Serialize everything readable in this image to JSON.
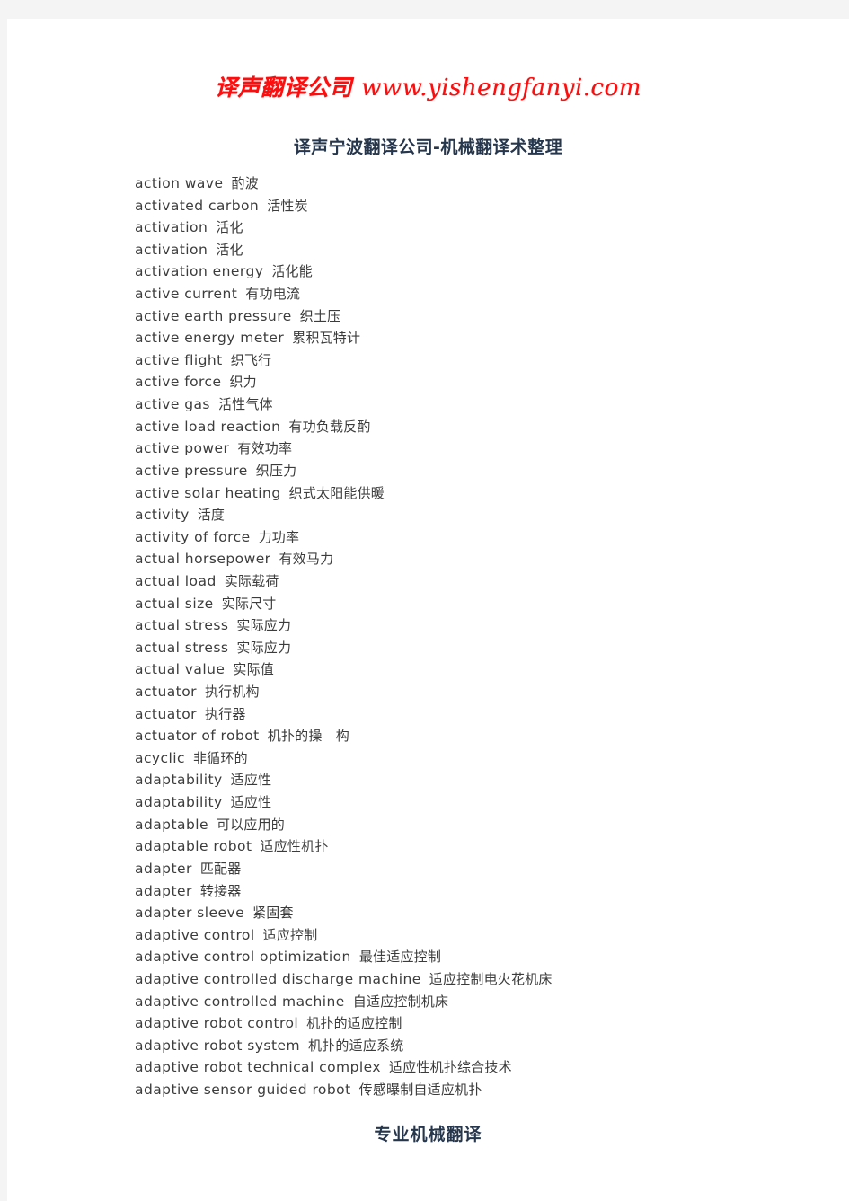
{
  "header": {
    "brand_cn": "译声翻译公司",
    "brand_url": "www.yishengfanyi.com",
    "brand_color": "#fd0d0d"
  },
  "title": "译声宁波翻译公司-机械翻译术整理",
  "footer": "专业机械翻译",
  "colors": {
    "page_background": "#ffffff",
    "canvas_background": "#f4f4f4",
    "title_color": "#26374d",
    "body_text": "#3c3c3c"
  },
  "glossary": [
    {
      "term": "action wave",
      "gloss": "酌波"
    },
    {
      "term": "activated carbon",
      "gloss": "活性炭"
    },
    {
      "term": "activation",
      "gloss": "活化"
    },
    {
      "term": "activation",
      "gloss": "活化"
    },
    {
      "term": "activation energy",
      "gloss": "活化能"
    },
    {
      "term": "active current",
      "gloss": "有功电流"
    },
    {
      "term": "active earth pressure",
      "gloss": "织土压"
    },
    {
      "term": "active energy meter",
      "gloss": "累积瓦特计"
    },
    {
      "term": "active flight",
      "gloss": "织飞行"
    },
    {
      "term": "active force",
      "gloss": "织力"
    },
    {
      "term": "active gas",
      "gloss": "活性气体"
    },
    {
      "term": "active load reaction",
      "gloss": "有功负载反酌"
    },
    {
      "term": "active power",
      "gloss": "有效功率"
    },
    {
      "term": "active pressure",
      "gloss": "织压力"
    },
    {
      "term": "active solar heating",
      "gloss": "织式太阳能供暖"
    },
    {
      "term": "activity",
      "gloss": "活度"
    },
    {
      "term": "activity of force",
      "gloss": "力功率"
    },
    {
      "term": "actual horsepower",
      "gloss": "有效马力"
    },
    {
      "term": "actual load",
      "gloss": "实际载荷"
    },
    {
      "term": "actual size",
      "gloss": "实际尺寸"
    },
    {
      "term": "actual stress",
      "gloss": "实际应力"
    },
    {
      "term": "actual stress",
      "gloss": "实际应力"
    },
    {
      "term": "actual value",
      "gloss": "实际值"
    },
    {
      "term": "actuator",
      "gloss": "执行机构"
    },
    {
      "term": "actuator",
      "gloss": "执行器"
    },
    {
      "term": "actuator of robot",
      "gloss": "机扑的操　构"
    },
    {
      "term": "acyclic",
      "gloss": "非循环的"
    },
    {
      "term": "adaptability",
      "gloss": "适应性"
    },
    {
      "term": "adaptability",
      "gloss": "适应性"
    },
    {
      "term": "adaptable",
      "gloss": "可以应用的"
    },
    {
      "term": "adaptable robot",
      "gloss": "适应性机扑"
    },
    {
      "term": "adapter",
      "gloss": "匹配器"
    },
    {
      "term": "adapter",
      "gloss": "转接器"
    },
    {
      "term": "adapter sleeve",
      "gloss": "紧固套"
    },
    {
      "term": "adaptive control",
      "gloss": "适应控制"
    },
    {
      "term": "adaptive control optimization",
      "gloss": "最佳适应控制"
    },
    {
      "term": "adaptive controlled discharge machine",
      "gloss": "适应控制电火花机床"
    },
    {
      "term": "adaptive controlled machine",
      "gloss": "自适应控制机床"
    },
    {
      "term": "adaptive robot control",
      "gloss": "机扑的适应控制"
    },
    {
      "term": "adaptive robot system",
      "gloss": "机扑的适应系统"
    },
    {
      "term": "adaptive robot technical complex",
      "gloss": "适应性机扑综合技术"
    },
    {
      "term": "adaptive sensor guided robot",
      "gloss": "传感曝制自适应机扑"
    }
  ]
}
